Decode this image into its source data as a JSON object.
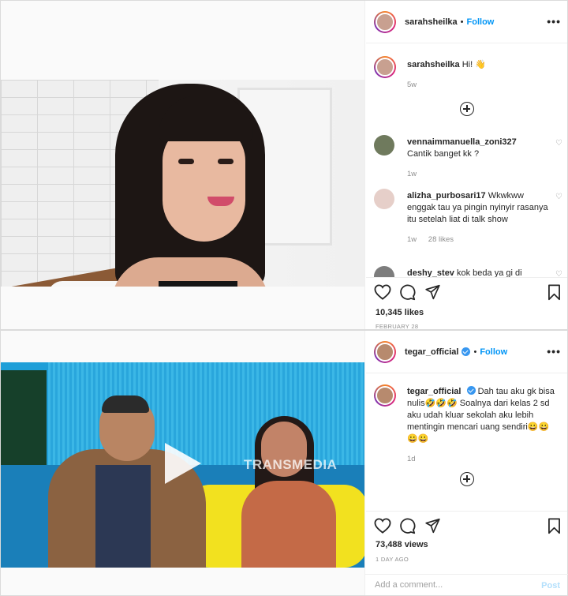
{
  "post1": {
    "author": {
      "username": "sarahsheilka",
      "dot": "•",
      "follow_label": "Follow"
    },
    "caption": {
      "username": "sarahsheilka",
      "text": "Hi! 👋",
      "time": "5w"
    },
    "comments": [
      {
        "username": "vennaimmanuella_zoni327",
        "text": "Cantik banget kk ?",
        "time": "1w",
        "likes": ""
      },
      {
        "username": "alizha_purbosari17",
        "text": "Wkwkww enggak tau ya pingin nyinyir rasanya itu setelah liat di talk show",
        "time": "1w",
        "likes": "28 likes"
      },
      {
        "username": "deshy_stev",
        "text": "kok beda ya gi di",
        "time": "",
        "likes": ""
      }
    ],
    "likes": "10,345 likes",
    "date": "FEBRUARY 28"
  },
  "post2": {
    "author": {
      "username": "tegar_official",
      "dot": "•",
      "follow_label": "Follow"
    },
    "caption": {
      "username": "tegar_official",
      "text": "Dah tau aku gk bisa nulis🤣🤣🤣 Soalnya dari kelas 2 sd aku udah kluar sekolah aku lebih mentingin mencari uang sendiri😀😀😀😀",
      "time": "1d"
    },
    "video_watermark": "TRANSMEDIA",
    "views": "73,488 views",
    "date": "1 DAY AGO"
  },
  "add_comment": {
    "placeholder": "Add a comment...",
    "post_label": "Post"
  },
  "icons": {
    "more": "•••",
    "heart": "heart-icon",
    "comment": "comment-icon",
    "share": "share-icon",
    "save": "bookmark-icon",
    "small_heart": "♡"
  },
  "colors": {
    "accent": "#0095f6",
    "verified": "#3897f0",
    "muted": "#8e8e8e",
    "post_disabled": "#b2dffc"
  }
}
